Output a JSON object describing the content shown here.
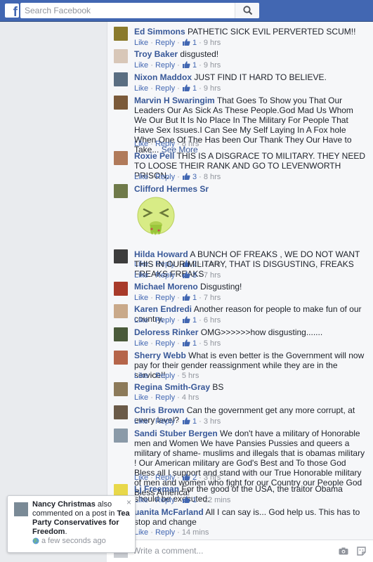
{
  "search": {
    "placeholder": "Search Facebook"
  },
  "comments": [
    {
      "name": "Ed Simmons",
      "text": "PATHETIC SICK EVIL PERVERTED SCUM!!",
      "like": "Like",
      "reply": "Reply",
      "likes": "1",
      "time": "9 hrs"
    },
    {
      "name": "Troy Baker",
      "text": "disgusted!",
      "like": "Like",
      "reply": "Reply",
      "likes": "1",
      "time": "9 hrs"
    },
    {
      "name": "Nixon Maddox",
      "text": "JUST FIND IT HARD TO BELIEVE.",
      "like": "Like",
      "reply": "Reply",
      "likes": "1",
      "time": "9 hrs"
    },
    {
      "name": "Marvin H Swaringim",
      "text": "That Goes To Show you That Our Leaders Our As Sick As These People.God Mad Us Whom We Our But It Is No Place In The Military For People That Have Sex Issues.I Can See My Self Laying In A Fox hole When One Of The Has been Our Thank They Our Have to Take...",
      "see_more": "See More",
      "like": "Like",
      "reply": "Reply",
      "time": "8 hrs"
    },
    {
      "name": "Roxie Pell",
      "text": "THIS IS A DISGRACE TO MILITARY. THEY NEED TO LOOSE THEIR RANK AND GO TO LEVENWORTH PRISON.",
      "like": "Like",
      "reply": "Reply",
      "likes": "3",
      "time": "8 hrs"
    },
    {
      "name": "Clifford Hermes Sr",
      "text": "",
      "like": "Like",
      "reply": "Reply",
      "likes": "2",
      "time": "7 hrs"
    },
    {
      "name": "Hilda Howard",
      "text": "A BUNCH OF FREAKS , WE DO NOT WANT THIS IN OUR MILITARY, THAT IS DISGUSTING, FREAKS FREAKS FREAKS",
      "like": "Like",
      "reply": "Reply",
      "likes": "3",
      "time": "7 hrs"
    },
    {
      "name": "Michael Moreno",
      "text": "Disgusting!",
      "like": "Like",
      "reply": "Reply",
      "likes": "1",
      "time": "7 hrs"
    },
    {
      "name": "Karen Endredi",
      "text": "Another reason for people to make fun of our country.",
      "like": "Like",
      "reply": "Reply",
      "likes": "1",
      "time": "6 hrs"
    },
    {
      "name": "Deloress Rinker",
      "text": "OMG>>>>>>how disgusting.......",
      "like": "Like",
      "reply": "Reply",
      "likes": "1",
      "time": "5 hrs"
    },
    {
      "name": "Sherry Webb",
      "text": "What is even better is the Government will now pay for their gender reassignment while they are in the service!!",
      "like": "Like",
      "reply": "Reply",
      "time": "5 hrs"
    },
    {
      "name": "Regina Smith-Gray",
      "text": "BS",
      "like": "Like",
      "reply": "Reply",
      "time": "4 hrs"
    },
    {
      "name": "Chris Brown",
      "text": "Can the government get any more corrupt, at every level?",
      "like": "Like",
      "reply": "Reply",
      "likes": "1",
      "time": "3 hrs"
    },
    {
      "name": "Sandi Stuber Bergen",
      "text": "We don't have a military of Honorable men and Women We have Pansies Pussies and queers a military of shame- muslims and illegals that is obamas military ! Our American military are God's Best and To those God Bless all I support and stand with our True Honorable military of men and women who fight for our Country our People God Bless America!",
      "like": "Like",
      "reply": "Reply",
      "likes": "2",
      "time": "3 hrs"
    },
    {
      "name": "Lj Freeman",
      "text": "For the good of the USA, the traitor Obama should be executed.",
      "like": "Like",
      "reply": "Reply",
      "likes": "1",
      "time": "22 mins"
    },
    {
      "name": "uanita McFarland",
      "text": "All I can say is... God help us. This has to stop and change",
      "like": "Like",
      "reply": "Reply",
      "time": "14 mins"
    }
  ],
  "write": {
    "placeholder": "Write a comment..."
  },
  "notification": {
    "actor": "Nancy Christmas",
    "mid": " also commented on a post in ",
    "group": "Tea Party Conservatives for Freedom",
    "end": ".",
    "time": "a few seconds ago",
    "close": "×"
  },
  "icons": {
    "search": "magnifier-icon",
    "like": "thumbs-up-icon",
    "camera": "camera-icon",
    "sticker": "sticker-icon",
    "globe": "globe-icon"
  },
  "colors": {
    "brand": "#4267b2",
    "link": "#385898",
    "muted": "#90949c"
  }
}
